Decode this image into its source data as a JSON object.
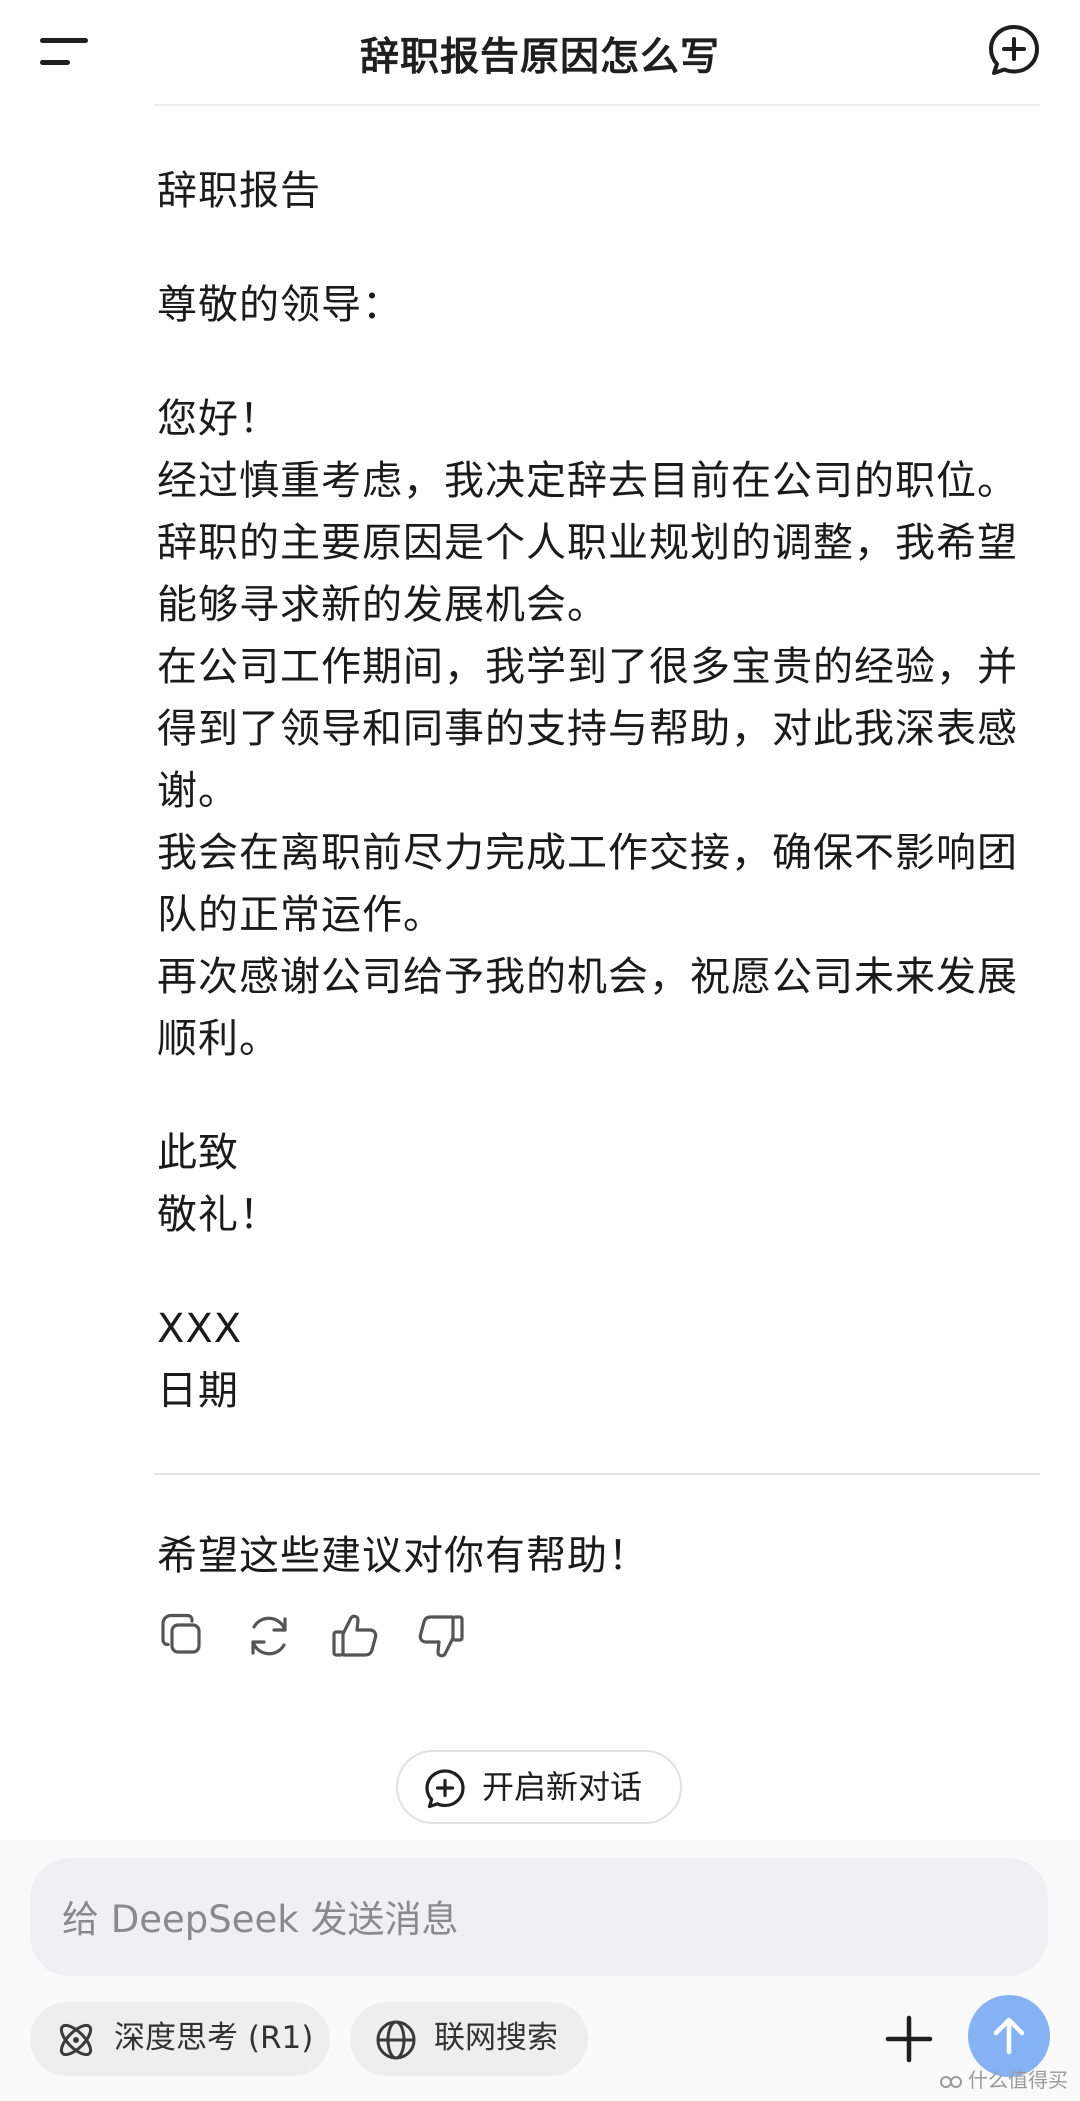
{
  "header": {
    "title": "辞职报告原因怎么写"
  },
  "letter": {
    "heading": "辞职报告",
    "salutation": "尊敬的领导：",
    "greeting": "您好！",
    "paragraphs": [
      "经过慎重考虑，我决定辞去目前在公司的职位。辞职的主要原因是个人职业规划的调整，我希望能够寻求新的发展机会。",
      "在公司工作期间，我学到了很多宝贵的经验，并得到了领导和同事的支持与帮助，对此我深表感谢。",
      "我会在离职前尽力完成工作交接，确保不影响团队的正常运作。",
      "再次感谢公司给予我的机会，祝愿公司未来发展顺利。"
    ],
    "sign_off_1": "此致",
    "sign_off_2": "敬礼！",
    "name": "XXX",
    "date": "日期"
  },
  "closing_message": "希望这些建议对你有帮助！",
  "actions": {
    "icons": [
      "copy-icon",
      "regenerate-icon",
      "thumbs-up-icon",
      "thumbs-down-icon"
    ]
  },
  "new_chat_button": {
    "label": "开启新对话",
    "icon": "chat-plus-icon"
  },
  "composer": {
    "placeholder": "给 DeepSeek 发送消息",
    "deep_think_label": "深度思考 (R1)",
    "web_search_label": "联网搜索",
    "send_button_color": "#85b2f5"
  },
  "watermark": {
    "text": "什么值得买"
  }
}
